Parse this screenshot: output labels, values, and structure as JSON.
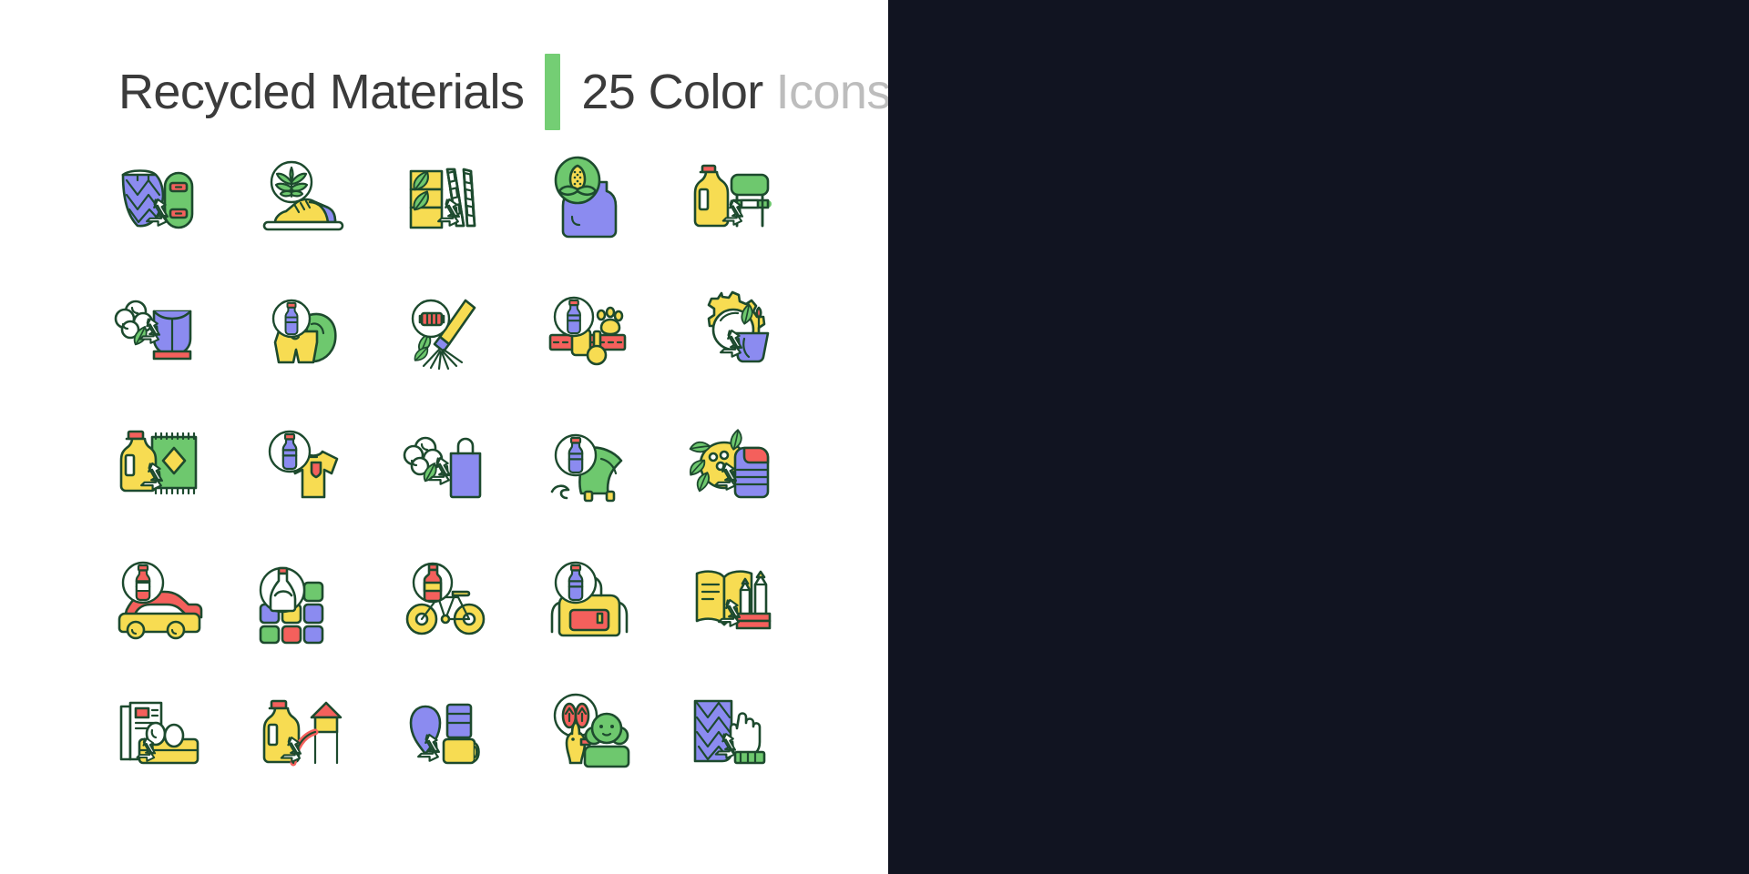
{
  "header": {
    "title_main": "Recycled Materials",
    "divider": "green-vertical-bar",
    "title_count": "25 Color",
    "title_sub": "Icons"
  },
  "palette": {
    "outline": "#1d4a2e",
    "green": "#6ec86e",
    "green_light": "#7bd07b",
    "yellow": "#f7dc52",
    "yellow_deep": "#f5d13c",
    "blue": "#8b8bf0",
    "red": "#f4605c",
    "white": "#ffffff",
    "dark_bg": "#111421",
    "title_dark": "#3b3b3b",
    "title_muted": "#bdbdbd",
    "accent_bar": "#74ce74"
  },
  "panels": [
    {
      "id": "light",
      "mode": "light",
      "background": "#ffffff"
    },
    {
      "id": "dark",
      "mode": "dark",
      "background": "#111421"
    }
  ],
  "icons": [
    {
      "row": 1,
      "col": 1,
      "name": "fishing-net-skateboard-icon",
      "label": "Recycled fishing net skateboard"
    },
    {
      "row": 1,
      "col": 2,
      "name": "hemp-sneaker-icon",
      "label": "Hemp sneaker"
    },
    {
      "row": 1,
      "col": 3,
      "name": "bamboo-paper-straws-icon",
      "label": "Bamboo paper straws"
    },
    {
      "row": 1,
      "col": 4,
      "name": "corn-bioplastic-bag-icon",
      "label": "Corn bioplastic bag"
    },
    {
      "row": 1,
      "col": 5,
      "name": "detergent-bottle-bench-icon",
      "label": "Detergent bottle bench"
    },
    {
      "row": 2,
      "col": 1,
      "name": "cotton-sports-top-icon",
      "label": "Recycled cotton sports top"
    },
    {
      "row": 2,
      "col": 2,
      "name": "bottle-swim-shorts-icon",
      "label": "Bottle swim shorts"
    },
    {
      "row": 2,
      "col": 3,
      "name": "bottle-broom-icon",
      "label": "Recycled broom"
    },
    {
      "row": 2,
      "col": 4,
      "name": "bottle-pet-collar-icon",
      "label": "Pet collar from bottles"
    },
    {
      "row": 2,
      "col": 5,
      "name": "gear-planter-pot-icon",
      "label": "Recycled planter pot"
    },
    {
      "row": 3,
      "col": 1,
      "name": "detergent-bottle-rug-icon",
      "label": "Recycled plastic rug"
    },
    {
      "row": 3,
      "col": 2,
      "name": "bottle-tshirt-icon",
      "label": "Recycled polyester t-shirt"
    },
    {
      "row": 3,
      "col": 3,
      "name": "cotton-tote-bag-icon",
      "label": "Recycled cotton tote bag"
    },
    {
      "row": 3,
      "col": 4,
      "name": "bottle-beach-towel-icon",
      "label": "Ocean plastic beach blanket"
    },
    {
      "row": 3,
      "col": 5,
      "name": "corn-sleeping-bag-icon",
      "label": "Recycled sleeping bag"
    },
    {
      "row": 4,
      "col": 1,
      "name": "bottle-car-parts-icon",
      "label": "Recycled car parts"
    },
    {
      "row": 4,
      "col": 2,
      "name": "glass-bottle-tiles-icon",
      "label": "Recycled glass tiles"
    },
    {
      "row": 4,
      "col": 3,
      "name": "bottle-bicycle-icon",
      "label": "Recycled bicycle"
    },
    {
      "row": 4,
      "col": 4,
      "name": "bottle-backpack-icon",
      "label": "Recycled backpack"
    },
    {
      "row": 4,
      "col": 5,
      "name": "notebook-pencils-icon",
      "label": "Recycled stationery"
    },
    {
      "row": 5,
      "col": 1,
      "name": "newspaper-egg-carton-icon",
      "label": "Recycled egg carton"
    },
    {
      "row": 5,
      "col": 2,
      "name": "bottle-playground-slide-icon",
      "label": "Recycled playground"
    },
    {
      "row": 5,
      "col": 3,
      "name": "bottle-yoga-mat-icon",
      "label": "Recycled yoga mat"
    },
    {
      "row": 5,
      "col": 4,
      "name": "flip-flops-toys-icon",
      "label": "Recycled toys"
    },
    {
      "row": 5,
      "col": 5,
      "name": "fishing-net-glove-icon",
      "label": "Recycled work glove"
    }
  ]
}
